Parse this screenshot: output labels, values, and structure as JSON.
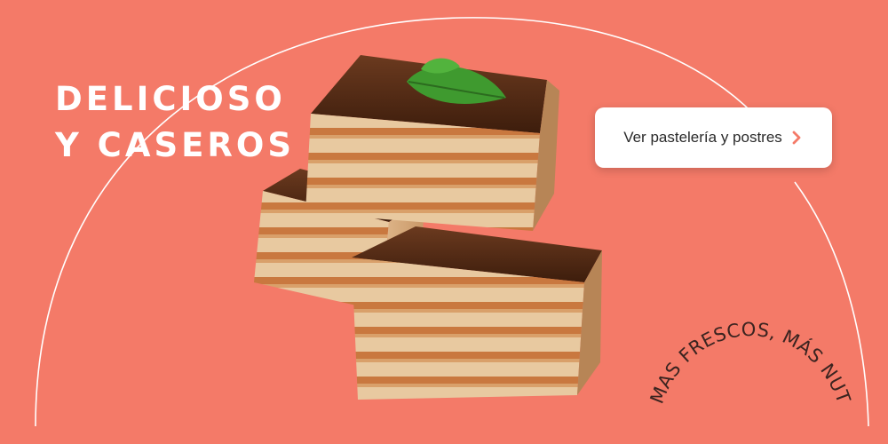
{
  "banner": {
    "background_color": "#f47a68",
    "headline": {
      "line1": "DELICIOSO",
      "line2": "Y CASEROS"
    },
    "cta": {
      "label": "Ver pastelería y postres",
      "icon": "chevron-right-icon",
      "icon_color": "#f47a68"
    },
    "tagline": "MAS FRESCOS, MÁS NUTRIIVOS",
    "product_image": "layered-chocolate-caramel-cake-squares-with-mint-leaf"
  }
}
